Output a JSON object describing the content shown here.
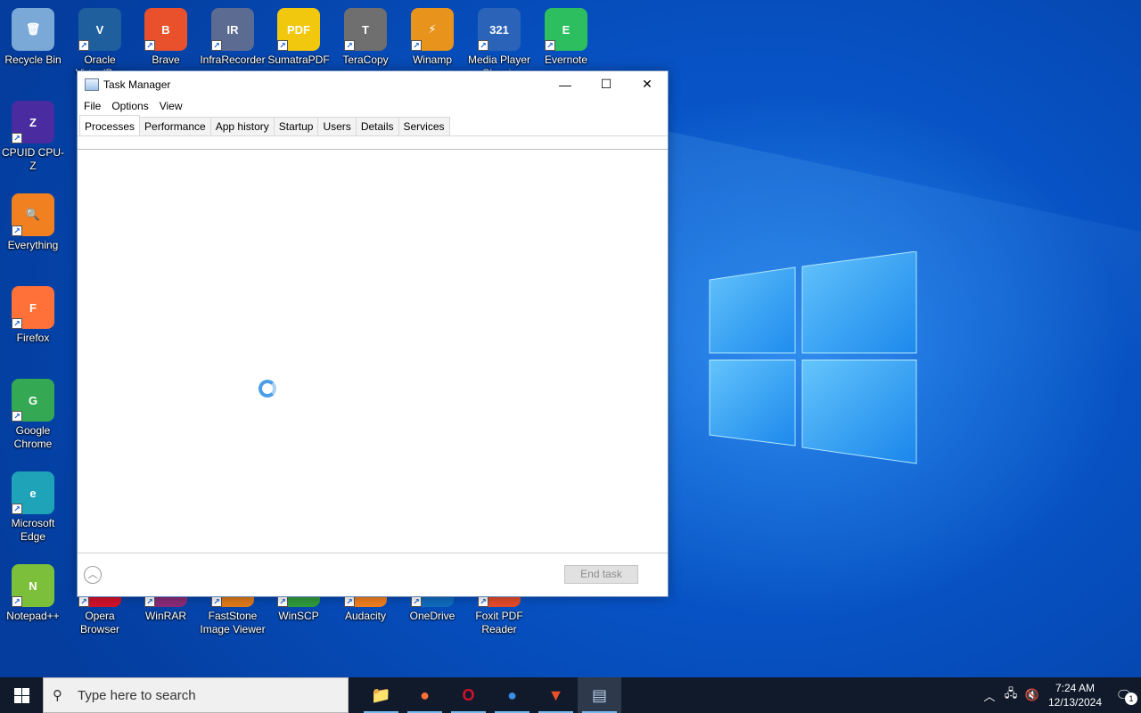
{
  "desktop": {
    "icons": [
      {
        "label": "Recycle Bin",
        "glyph": "🗑",
        "color": "#7aa9d8"
      },
      {
        "label": "Oracle VirtualBox",
        "glyph": "V",
        "color": "#1f5f9e"
      },
      {
        "label": "Brave",
        "glyph": "B",
        "color": "#e8512b"
      },
      {
        "label": "InfraRecorder",
        "glyph": "IR",
        "color": "#5c6b91"
      },
      {
        "label": "SumatraPDF",
        "glyph": "PDF",
        "color": "#f2c80f"
      },
      {
        "label": "TeraCopy",
        "glyph": "T",
        "color": "#6f6f6f"
      },
      {
        "label": "Winamp",
        "glyph": "⚡",
        "color": "#e8931b"
      },
      {
        "label": "Media Player Classic",
        "glyph": "321",
        "color": "#2a63b7"
      },
      {
        "label": "Evernote",
        "glyph": "E",
        "color": "#2dbe60"
      },
      {
        "label": "CPUID CPU-Z",
        "glyph": "Z",
        "color": "#4a2ca0"
      },
      {
        "label": "Everything",
        "glyph": "🔍",
        "color": "#f08020"
      },
      {
        "label": "Firefox",
        "glyph": "F",
        "color": "#ff7139"
      },
      {
        "label": "Google Chrome",
        "glyph": "G",
        "color": "#34a853"
      },
      {
        "label": "Microsoft Edge",
        "glyph": "e",
        "color": "#1ea3b8"
      },
      {
        "label": "Notepad++",
        "glyph": "N",
        "color": "#7cbf3a"
      },
      {
        "label": "Opera Browser",
        "glyph": "O",
        "color": "#d3122c"
      },
      {
        "label": "WinRAR",
        "glyph": "R",
        "color": "#8a2b78"
      },
      {
        "label": "FastStone Image Viewer",
        "glyph": "FS",
        "color": "#e07b1a"
      },
      {
        "label": "WinSCP",
        "glyph": "S",
        "color": "#2f9b3c"
      },
      {
        "label": "Audacity",
        "glyph": "A",
        "color": "#f07f1f"
      },
      {
        "label": "OneDrive",
        "glyph": "☁",
        "color": "#0f6cbd"
      },
      {
        "label": "Foxit PDF Reader",
        "glyph": "F",
        "color": "#e34b2a"
      }
    ]
  },
  "task_manager": {
    "title": "Task Manager",
    "controls": {
      "minimize": "—",
      "maximize": "☐",
      "close": "✕"
    },
    "menu": [
      "File",
      "Options",
      "View"
    ],
    "tabs": [
      "Processes",
      "Performance",
      "App history",
      "Startup",
      "Users",
      "Details",
      "Services"
    ],
    "active_tab": "Processes",
    "loading": true,
    "footer": {
      "fewer_details_glyph": "︿",
      "end_task_label": "End task"
    }
  },
  "taskbar": {
    "search_placeholder": "Type here to search",
    "apps": [
      {
        "name": "file-explorer",
        "glyph": "📁",
        "color": "#f3c13a"
      },
      {
        "name": "firefox",
        "glyph": "●",
        "color": "#ff7139"
      },
      {
        "name": "opera",
        "glyph": "O",
        "color": "#d3122c"
      },
      {
        "name": "thunderbird",
        "glyph": "●",
        "color": "#3b8ee8"
      },
      {
        "name": "brave",
        "glyph": "▼",
        "color": "#e8512b"
      },
      {
        "name": "task-manager",
        "glyph": "▤",
        "color": "#b8cde8"
      }
    ],
    "time": "7:24 AM",
    "date": "12/13/2024",
    "notification_count": "1"
  }
}
